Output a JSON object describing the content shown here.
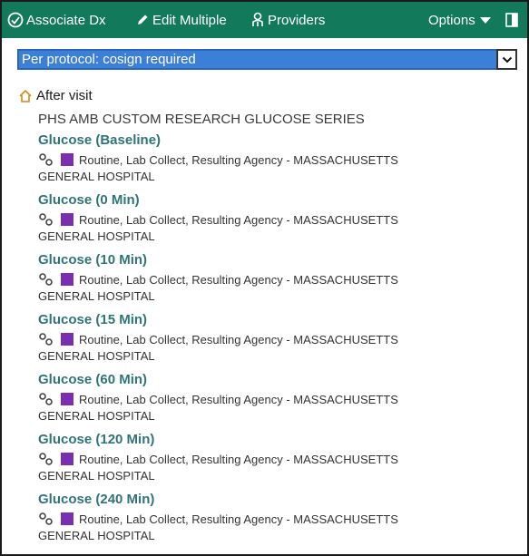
{
  "toolbar": {
    "associate_dx": "Associate Dx",
    "edit_multiple": "Edit Multiple",
    "providers": "Providers",
    "options": "Options"
  },
  "protocol": {
    "selected": "Per protocol: cosign required"
  },
  "section": {
    "label": "After visit",
    "group_title": "PHS AMB CUSTOM RESEARCH GLUCOSE SERIES"
  },
  "orders": [
    {
      "name": "Glucose (Baseline)",
      "details": "Routine, Lab Collect, Resulting Agency - MASSACHUSETTS",
      "details_cont": "GENERAL HOSPITAL"
    },
    {
      "name": "Glucose (0 Min)",
      "details": "Routine, Lab Collect, Resulting Agency - MASSACHUSETTS",
      "details_cont": "GENERAL HOSPITAL"
    },
    {
      "name": "Glucose (10 Min)",
      "details": "Routine, Lab Collect, Resulting Agency - MASSACHUSETTS",
      "details_cont": "GENERAL HOSPITAL"
    },
    {
      "name": "Glucose (15 Min)",
      "details": "Routine, Lab Collect, Resulting Agency - MASSACHUSETTS",
      "details_cont": "GENERAL HOSPITAL"
    },
    {
      "name": "Glucose (60 Min)",
      "details": "Routine, Lab Collect, Resulting Agency - MASSACHUSETTS",
      "details_cont": "GENERAL HOSPITAL"
    },
    {
      "name": "Glucose (120 Min)",
      "details": "Routine, Lab Collect, Resulting Agency - MASSACHUSETTS",
      "details_cont": "GENERAL HOSPITAL"
    },
    {
      "name": "Glucose (240 Min)",
      "details": "Routine, Lab Collect, Resulting Agency - MASSACHUSETTS",
      "details_cont": "GENERAL HOSPITAL"
    }
  ],
  "icons": {
    "associate": "associate-dx-icon",
    "edit": "pencil-icon",
    "providers": "providers-icon",
    "options_arrow": "caret-down-icon",
    "panel": "panel-toggle-icon",
    "section": "home-icon",
    "order_link": "linked-rings-icon",
    "order_status": "purple-square-icon"
  },
  "colors": {
    "toolbar_bg": "#127a5a",
    "select_bg": "#3c7fd6",
    "order_name": "#2f7478",
    "status_square": "#7a2fb0"
  }
}
